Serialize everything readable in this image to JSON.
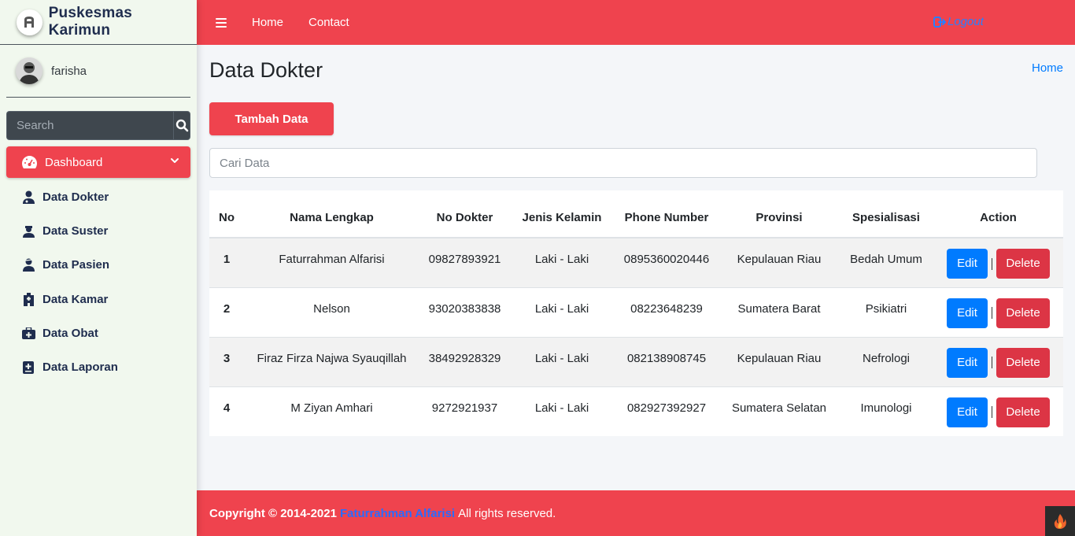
{
  "brand": {
    "name": "Puskesmas Karimun"
  },
  "user": {
    "name": "farisha"
  },
  "sidebar": {
    "search_placeholder": "Search",
    "active": {
      "label": "Dashboard",
      "icon": "tachometer-icon"
    },
    "items": [
      {
        "label": "Data Dokter",
        "icon": "user-doctor-icon"
      },
      {
        "label": "Data Suster",
        "icon": "user-nurse-icon"
      },
      {
        "label": "Data Pasien",
        "icon": "user-injured-icon"
      },
      {
        "label": "Data Kamar",
        "icon": "hospital-icon"
      },
      {
        "label": "Data Obat",
        "icon": "medkit-icon"
      },
      {
        "label": "Data Laporan",
        "icon": "file-medical-icon"
      }
    ]
  },
  "navbar": {
    "links": [
      "Home",
      "Contact"
    ],
    "logout": "Logout"
  },
  "main": {
    "title": "Data Dokter",
    "breadcrumb": "Home",
    "add_button": "Tambah Data",
    "search_placeholder": "Cari Data",
    "table": {
      "headers": [
        "No",
        "Nama Lengkap",
        "No Dokter",
        "Jenis Kelamin",
        "Phone Number",
        "Provinsi",
        "Spesialisasi",
        "Action"
      ],
      "rows": [
        [
          "1",
          "Faturrahman Alfarisi",
          "09827893921",
          "Laki - Laki",
          "0895360020446",
          "Kepulauan Riau",
          "Bedah Umum"
        ],
        [
          "2",
          "Nelson",
          "93020383838",
          "Laki - Laki",
          "08223648239",
          "Sumatera Barat",
          "Psikiatri"
        ],
        [
          "3",
          "Firaz Firza Najwa Syauqillah",
          "38492928329",
          "Laki - Laki",
          "082138908745",
          "Kepulauan Riau",
          "Nefrologi"
        ],
        [
          "4",
          "M Ziyan Amhari",
          "9272921937",
          "Laki - Laki",
          "082927392927",
          "Sumatera Selatan",
          "Imunologi"
        ]
      ],
      "edit_label": "Edit",
      "delete_label": "Delete"
    }
  },
  "footer": {
    "copyright": "Copyright © 2014-2021",
    "author": "Faturrahman Alfarisi",
    "rights": "All rights reserved."
  },
  "colors": {
    "accent": "#ef434e",
    "sidebar_bg": "#f1f8ee",
    "link": "#007bff",
    "edit": "#007bff",
    "delete": "#dc3545"
  }
}
